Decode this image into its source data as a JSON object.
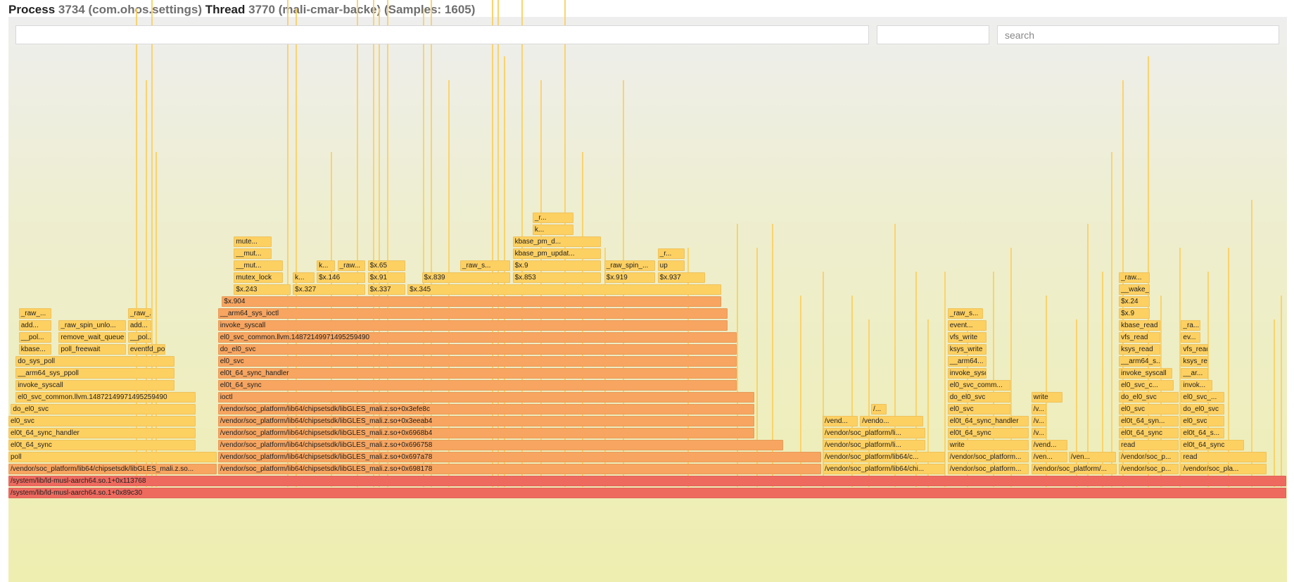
{
  "header": {
    "process_label": "Process",
    "process_id": "3734",
    "process_name": "(com.ohos.settings)",
    "thread_label": "Thread",
    "thread_id": "3770",
    "thread_name": "(mali-cmar-backe)",
    "samples": "(Samples: 1605)"
  },
  "inputs": {
    "filter1_value": "",
    "filter2_value": "",
    "search_placeholder": "search"
  },
  "colors": {
    "frame_orange": "#f7a560",
    "frame_yellow": "#fdd062",
    "frame_red": "#ee6a5f",
    "background_top": "#eeeeee",
    "background_bottom": "#eeeeb0"
  },
  "frames": [
    {
      "l": 0,
      "depth": 0,
      "s": 1605,
      "c": 2,
      "name": "/system/lib/ld-musl-aarch64.so.1+0x89c30"
    },
    {
      "l": 0,
      "depth": 1,
      "s": 1605,
      "c": 2,
      "name": "/system/lib/ld-musl-aarch64.so.1+0x113768"
    },
    {
      "l": 0,
      "depth": 2,
      "s": 262,
      "c": 0,
      "name": "/vendor/soc_platform/lib64/chipsetsdk/libGLES_mali.z.so..."
    },
    {
      "l": 263,
      "depth": 2,
      "s": 758,
      "c": 0,
      "name": "/vendor/soc_platform/lib64/chipsetsdk/libGLES_mali.z.so+0x698178"
    },
    {
      "l": 1022,
      "depth": 2,
      "s": 155,
      "c": 1,
      "name": "/vendor/soc_platform/lib64/chi..."
    },
    {
      "l": 1179,
      "depth": 2,
      "s": 103,
      "c": 1,
      "name": "/vendor/soc_platform..."
    },
    {
      "l": 1284,
      "depth": 2,
      "s": 108,
      "c": 1,
      "name": "/vendor/soc_platform/..."
    },
    {
      "l": 1394,
      "depth": 2,
      "s": 76,
      "c": 1,
      "name": "/vendor/soc_p..."
    },
    {
      "l": 1472,
      "depth": 2,
      "s": 108,
      "c": 1,
      "name": "/vendor/soc_pla..."
    },
    {
      "l": 0,
      "depth": 3,
      "s": 262,
      "c": 1,
      "name": "poll"
    },
    {
      "l": 263,
      "depth": 3,
      "s": 758,
      "c": 0,
      "name": "/vendor/soc_platform/lib64/chipsetsdk/libGLES_mali.z.so+0x697a78"
    },
    {
      "l": 1022,
      "depth": 3,
      "s": 155,
      "c": 1,
      "name": "/vendor/soc_platform/lib64/c..."
    },
    {
      "l": 1179,
      "depth": 3,
      "s": 103,
      "c": 1,
      "name": "/vendor/soc_platform..."
    },
    {
      "l": 1284,
      "depth": 3,
      "s": 46,
      "c": 1,
      "name": "/ven..."
    },
    {
      "l": 1331,
      "depth": 3,
      "s": 60,
      "c": 1,
      "name": "/ven..."
    },
    {
      "l": 1394,
      "depth": 3,
      "s": 76,
      "c": 1,
      "name": "/vendor/soc_p..."
    },
    {
      "l": 1472,
      "depth": 3,
      "s": 108,
      "c": 1,
      "name": "read"
    },
    {
      "l": 0,
      "depth": 4,
      "s": 236,
      "c": 1,
      "name": "el0t_64_sync"
    },
    {
      "l": 263,
      "depth": 4,
      "s": 710,
      "c": 0,
      "name": "/vendor/soc_platform/lib64/chipsetsdk/libGLES_mali.z.so+0x696758"
    },
    {
      "l": 1022,
      "depth": 4,
      "s": 130,
      "c": 1,
      "name": "/vendor/soc_platform/li..."
    },
    {
      "l": 1179,
      "depth": 4,
      "s": 103,
      "c": 1,
      "name": "write"
    },
    {
      "l": 1284,
      "depth": 4,
      "s": 46,
      "c": 1,
      "name": "/vend..."
    },
    {
      "l": 1394,
      "depth": 4,
      "s": 76,
      "c": 1,
      "name": "read"
    },
    {
      "l": 1472,
      "depth": 4,
      "s": 80,
      "c": 1,
      "name": "el0t_64_sync"
    },
    {
      "l": 0,
      "depth": 5,
      "s": 236,
      "c": 1,
      "name": "el0t_64_sync_handler"
    },
    {
      "l": 263,
      "depth": 5,
      "s": 674,
      "c": 0,
      "name": "/vendor/soc_platform/lib64/chipsetsdk/libGLES_mali.z.so+0x6968b4"
    },
    {
      "l": 1022,
      "depth": 5,
      "s": 130,
      "c": 1,
      "name": "/vendor/soc_platform/li..."
    },
    {
      "l": 1179,
      "depth": 5,
      "s": 103,
      "c": 1,
      "name": "el0t_64_sync"
    },
    {
      "l": 1284,
      "depth": 5,
      "s": 20,
      "c": 1,
      "name": "/v..."
    },
    {
      "l": 1394,
      "depth": 5,
      "s": 76,
      "c": 1,
      "name": "el0t_64_sync"
    },
    {
      "l": 1472,
      "depth": 5,
      "s": 55,
      "c": 1,
      "name": "el0t_64_s..."
    },
    {
      "l": 0,
      "depth": 6,
      "s": 236,
      "c": 1,
      "name": "el0_svc"
    },
    {
      "l": 263,
      "depth": 6,
      "s": 674,
      "c": 0,
      "name": "/vendor/soc_platform/lib64/chipsetsdk/libGLES_mali.z.so+0x3eeab4"
    },
    {
      "l": 1022,
      "depth": 6,
      "s": 45,
      "c": 1,
      "name": "/vend..."
    },
    {
      "l": 1069,
      "depth": 6,
      "s": 80,
      "c": 1,
      "name": "/vendo..."
    },
    {
      "l": 1179,
      "depth": 6,
      "s": 103,
      "c": 1,
      "name": "el0t_64_sync_handler"
    },
    {
      "l": 1284,
      "depth": 6,
      "s": 20,
      "c": 1,
      "name": "/v..."
    },
    {
      "l": 1394,
      "depth": 6,
      "s": 76,
      "c": 1,
      "name": "el0t_64_syn..."
    },
    {
      "l": 1472,
      "depth": 6,
      "s": 55,
      "c": 1,
      "name": "el0_svc"
    },
    {
      "l": 3,
      "depth": 7,
      "s": 233,
      "c": 1,
      "name": "do_el0_svc"
    },
    {
      "l": 263,
      "depth": 7,
      "s": 674,
      "c": 0,
      "name": "/vendor/soc_platform/lib64/chipsetsdk/libGLES_mali.z.so+0x3efe8c"
    },
    {
      "l": 1083,
      "depth": 7,
      "s": 20,
      "c": 1,
      "name": "/..."
    },
    {
      "l": 1179,
      "depth": 7,
      "s": 80,
      "c": 1,
      "name": "el0_svc"
    },
    {
      "l": 1284,
      "depth": 7,
      "s": 20,
      "c": 1,
      "name": "/v..."
    },
    {
      "l": 1394,
      "depth": 7,
      "s": 76,
      "c": 1,
      "name": "el0_svc"
    },
    {
      "l": 1472,
      "depth": 7,
      "s": 55,
      "c": 1,
      "name": "do_el0_svc"
    },
    {
      "l": 9,
      "depth": 8,
      "s": 227,
      "c": 1,
      "name": "el0_svc_common.llvm.14872149971495259490"
    },
    {
      "l": 263,
      "depth": 8,
      "s": 674,
      "c": 0,
      "name": "ioctl"
    },
    {
      "l": 1179,
      "depth": 8,
      "s": 80,
      "c": 1,
      "name": "do_el0_svc"
    },
    {
      "l": 1284,
      "depth": 8,
      "s": 40,
      "c": 1,
      "name": "write"
    },
    {
      "l": 1394,
      "depth": 8,
      "s": 76,
      "c": 1,
      "name": "do_el0_svc"
    },
    {
      "l": 1472,
      "depth": 8,
      "s": 55,
      "c": 1,
      "name": "el0_svc_..."
    },
    {
      "l": 9,
      "depth": 9,
      "s": 200,
      "c": 1,
      "name": "invoke_syscall"
    },
    {
      "l": 263,
      "depth": 9,
      "s": 652,
      "c": 0,
      "name": "el0t_64_sync"
    },
    {
      "l": 1179,
      "depth": 9,
      "s": 80,
      "c": 1,
      "name": "el0_svc_comm..."
    },
    {
      "l": 1394,
      "depth": 9,
      "s": 70,
      "c": 1,
      "name": "el0_svc_c..."
    },
    {
      "l": 1472,
      "depth": 9,
      "s": 40,
      "c": 1,
      "name": "invok..."
    },
    {
      "l": 9,
      "depth": 10,
      "s": 200,
      "c": 1,
      "name": "__arm64_sys_ppoll"
    },
    {
      "l": 263,
      "depth": 10,
      "s": 652,
      "c": 0,
      "name": "el0t_64_sync_handler"
    },
    {
      "l": 1179,
      "depth": 10,
      "s": 50,
      "c": 1,
      "name": "invoke_syscall"
    },
    {
      "l": 1394,
      "depth": 10,
      "s": 68,
      "c": 1,
      "name": "invoke_syscall"
    },
    {
      "l": 1472,
      "depth": 10,
      "s": 35,
      "c": 1,
      "name": "__ar..."
    },
    {
      "l": 9,
      "depth": 11,
      "s": 200,
      "c": 1,
      "name": "do_sys_poll"
    },
    {
      "l": 263,
      "depth": 11,
      "s": 652,
      "c": 0,
      "name": "el0_svc"
    },
    {
      "l": 1179,
      "depth": 11,
      "s": 50,
      "c": 1,
      "name": "__arm64..."
    },
    {
      "l": 1394,
      "depth": 11,
      "s": 53,
      "c": 1,
      "name": "__arm64_s..."
    },
    {
      "l": 1472,
      "depth": 11,
      "s": 35,
      "c": 1,
      "name": "ksys_read"
    },
    {
      "l": 13,
      "depth": 12,
      "s": 42,
      "c": 1,
      "name": "kbase..."
    },
    {
      "l": 63,
      "depth": 12,
      "s": 85,
      "c": 1,
      "name": "poll_freewait"
    },
    {
      "l": 150,
      "depth": 12,
      "s": 48,
      "c": 1,
      "name": "eventfd_poll"
    },
    {
      "l": 263,
      "depth": 12,
      "s": 652,
      "c": 0,
      "name": "do_el0_svc"
    },
    {
      "l": 1179,
      "depth": 12,
      "s": 50,
      "c": 1,
      "name": "ksys_write"
    },
    {
      "l": 1394,
      "depth": 12,
      "s": 53,
      "c": 1,
      "name": "ksys_read"
    },
    {
      "l": 1472,
      "depth": 12,
      "s": 35,
      "c": 1,
      "name": "vfs_read"
    },
    {
      "l": 13,
      "depth": 13,
      "s": 42,
      "c": 1,
      "name": "__pol..."
    },
    {
      "l": 63,
      "depth": 13,
      "s": 85,
      "c": 1,
      "name": "remove_wait_queue"
    },
    {
      "l": 150,
      "depth": 13,
      "s": 30,
      "c": 1,
      "name": "__pol..."
    },
    {
      "l": 263,
      "depth": 13,
      "s": 652,
      "c": 0,
      "name": "el0_svc_common.llvm.14872149971495259490"
    },
    {
      "l": 1179,
      "depth": 13,
      "s": 50,
      "c": 1,
      "name": "vfs_write"
    },
    {
      "l": 1394,
      "depth": 13,
      "s": 53,
      "c": 1,
      "name": "vfs_read"
    },
    {
      "l": 1472,
      "depth": 13,
      "s": 25,
      "c": 1,
      "name": "ev..."
    },
    {
      "l": 13,
      "depth": 14,
      "s": 42,
      "c": 1,
      "name": "add..."
    },
    {
      "l": 63,
      "depth": 14,
      "s": 85,
      "c": 1,
      "name": "_raw_spin_unlo..."
    },
    {
      "l": 150,
      "depth": 14,
      "s": 30,
      "c": 1,
      "name": "add..."
    },
    {
      "l": 263,
      "depth": 14,
      "s": 641,
      "c": 0,
      "name": "invoke_syscall"
    },
    {
      "l": 1179,
      "depth": 14,
      "s": 50,
      "c": 1,
      "name": "event..."
    },
    {
      "l": 1394,
      "depth": 14,
      "s": 53,
      "c": 1,
      "name": "kbase_read"
    },
    {
      "l": 1472,
      "depth": 14,
      "s": 25,
      "c": 1,
      "name": "_ra..."
    },
    {
      "l": 13,
      "depth": 15,
      "s": 42,
      "c": 1,
      "name": "_raw_..."
    },
    {
      "l": 150,
      "depth": 15,
      "s": 30,
      "c": 1,
      "name": "_raw_..."
    },
    {
      "l": 263,
      "depth": 15,
      "s": 641,
      "c": 0,
      "name": "__arm64_sys_ioctl"
    },
    {
      "l": 1179,
      "depth": 15,
      "s": 45,
      "c": 1,
      "name": "_raw_s..."
    },
    {
      "l": 1394,
      "depth": 15,
      "s": 40,
      "c": 1,
      "name": "$x.9"
    },
    {
      "l": 268,
      "depth": 16,
      "s": 628,
      "c": 0,
      "name": "$x.904"
    },
    {
      "l": 1394,
      "depth": 16,
      "s": 40,
      "c": 1,
      "name": "$x.24"
    },
    {
      "l": 283,
      "depth": 17,
      "s": 72,
      "c": 1,
      "name": "$x.243"
    },
    {
      "l": 357,
      "depth": 17,
      "s": 92,
      "c": 1,
      "name": "$x.327"
    },
    {
      "l": 451,
      "depth": 17,
      "s": 48,
      "c": 1,
      "name": "$x.337"
    },
    {
      "l": 501,
      "depth": 17,
      "s": 395,
      "c": 1,
      "name": "$x.345"
    },
    {
      "l": 1394,
      "depth": 17,
      "s": 40,
      "c": 1,
      "name": "__wake_up"
    },
    {
      "l": 283,
      "depth": 18,
      "s": 62,
      "c": 1,
      "name": "mutex_lock"
    },
    {
      "l": 357,
      "depth": 18,
      "s": 28,
      "c": 1,
      "name": "k..."
    },
    {
      "l": 387,
      "depth": 18,
      "s": 62,
      "c": 1,
      "name": "$x.146"
    },
    {
      "l": 451,
      "depth": 18,
      "s": 48,
      "c": 1,
      "name": "$x.91"
    },
    {
      "l": 519,
      "depth": 18,
      "s": 112,
      "c": 1,
      "name": "$x.839"
    },
    {
      "l": 633,
      "depth": 18,
      "s": 112,
      "c": 1,
      "name": "$x.853"
    },
    {
      "l": 748,
      "depth": 18,
      "s": 65,
      "c": 1,
      "name": "$x.919"
    },
    {
      "l": 815,
      "depth": 18,
      "s": 60,
      "c": 1,
      "name": "$x.937"
    },
    {
      "l": 1394,
      "depth": 18,
      "s": 40,
      "c": 1,
      "name": "_raw..."
    },
    {
      "l": 283,
      "depth": 19,
      "s": 62,
      "c": 1,
      "name": "__mut..."
    },
    {
      "l": 387,
      "depth": 19,
      "s": 24,
      "c": 1,
      "name": "k..."
    },
    {
      "l": 413,
      "depth": 19,
      "s": 36,
      "c": 1,
      "name": "_raw..."
    },
    {
      "l": 451,
      "depth": 19,
      "s": 48,
      "c": 1,
      "name": "$x.65"
    },
    {
      "l": 567,
      "depth": 19,
      "s": 64,
      "c": 1,
      "name": "_raw_s..."
    },
    {
      "l": 633,
      "depth": 19,
      "s": 112,
      "c": 1,
      "name": "$x.9"
    },
    {
      "l": 748,
      "depth": 19,
      "s": 65,
      "c": 1,
      "name": "_raw_spin_..."
    },
    {
      "l": 815,
      "depth": 19,
      "s": 35,
      "c": 1,
      "name": "up"
    },
    {
      "l": 283,
      "depth": 20,
      "s": 48,
      "c": 1,
      "name": "__mut..."
    },
    {
      "l": 633,
      "depth": 20,
      "s": 112,
      "c": 1,
      "name": "kbase_pm_updat..."
    },
    {
      "l": 815,
      "depth": 20,
      "s": 35,
      "c": 1,
      "name": "_r..."
    },
    {
      "l": 283,
      "depth": 21,
      "s": 48,
      "c": 1,
      "name": "mute..."
    },
    {
      "l": 633,
      "depth": 21,
      "s": 112,
      "c": 1,
      "name": "kbase_pm_d..."
    },
    {
      "l": 658,
      "depth": 22,
      "s": 52,
      "c": 1,
      "name": "k..."
    },
    {
      "l": 658,
      "depth": 23,
      "s": 52,
      "c": 1,
      "name": "_r..."
    }
  ]
}
